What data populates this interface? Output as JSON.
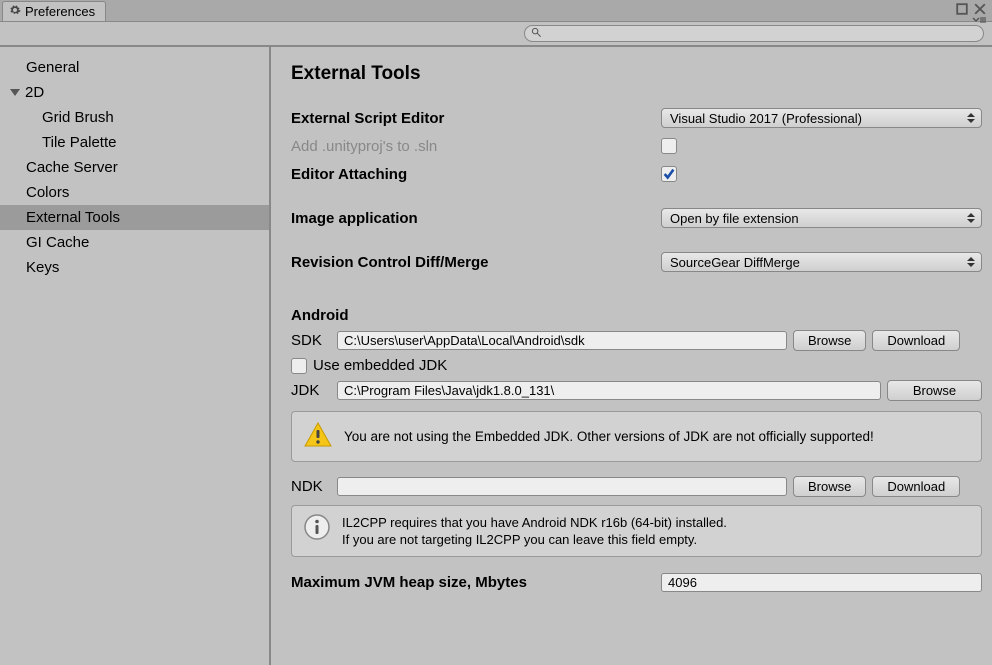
{
  "tab": {
    "title": "Preferences"
  },
  "search": {
    "placeholder": ""
  },
  "sidebar": {
    "items": [
      {
        "label": "General"
      },
      {
        "label": "2D"
      },
      {
        "label": "Grid Brush"
      },
      {
        "label": "Tile Palette"
      },
      {
        "label": "Cache Server"
      },
      {
        "label": "Colors"
      },
      {
        "label": "External Tools"
      },
      {
        "label": "GI Cache"
      },
      {
        "label": "Keys"
      }
    ]
  },
  "content": {
    "title": "External Tools",
    "scriptEditor": {
      "label": "External Script Editor",
      "value": "Visual Studio 2017 (Professional)"
    },
    "addUnityProj": {
      "label": "Add .unityproj's to .sln"
    },
    "editorAttaching": {
      "label": "Editor Attaching"
    },
    "imageApp": {
      "label": "Image application",
      "value": "Open by file extension"
    },
    "revisionControl": {
      "label": "Revision Control Diff/Merge",
      "value": "SourceGear DiffMerge"
    },
    "android": {
      "heading": "Android",
      "sdk": {
        "label": "SDK",
        "value": "C:\\Users\\user\\AppData\\Local\\Android\\sdk"
      },
      "useEmbedded": {
        "label": "Use embedded JDK"
      },
      "jdk": {
        "label": "JDK",
        "value": "C:\\Program Files\\Java\\jdk1.8.0_131\\"
      },
      "warning": "You are not using the Embedded JDK. Other versions of JDK are not officially supported!",
      "ndk": {
        "label": "NDK",
        "value": ""
      },
      "info": "IL2CPP requires that you have Android NDK r16b (64-bit) installed.\nIf you are not targeting IL2CPP you can leave this field empty.",
      "jvm": {
        "label": "Maximum JVM heap size, Mbytes",
        "value": "4096"
      }
    },
    "buttons": {
      "browse": "Browse",
      "download": "Download"
    }
  }
}
